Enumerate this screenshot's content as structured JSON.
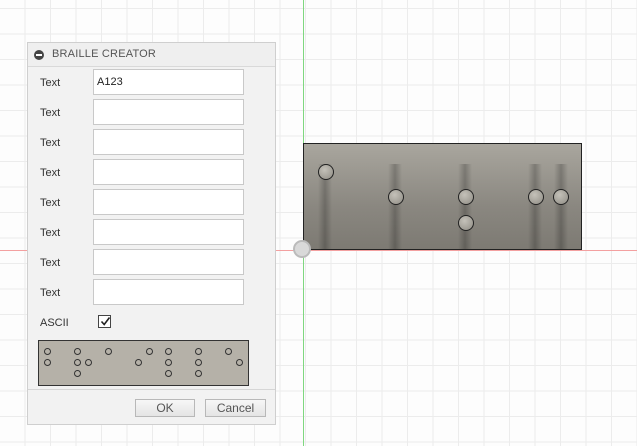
{
  "dialog": {
    "title": "BRAILLE CREATOR",
    "rows": [
      {
        "label": "Text",
        "value": "A123"
      },
      {
        "label": "Text",
        "value": ""
      },
      {
        "label": "Text",
        "value": ""
      },
      {
        "label": "Text",
        "value": ""
      },
      {
        "label": "Text",
        "value": ""
      },
      {
        "label": "Text",
        "value": ""
      },
      {
        "label": "Text",
        "value": ""
      },
      {
        "label": "Text",
        "value": ""
      }
    ],
    "ascii_label": "ASCII",
    "ascii_checked": true,
    "ok_label": "OK",
    "cancel_label": "Cancel"
  },
  "icons": {
    "collapse": "minus-circle-icon",
    "checkmark": "checkmark-icon",
    "origin": "origin-icon"
  },
  "colors": {
    "x_axis": "#f3a0a0",
    "y_axis": "#7fd77f",
    "plate": "#8a8780"
  }
}
